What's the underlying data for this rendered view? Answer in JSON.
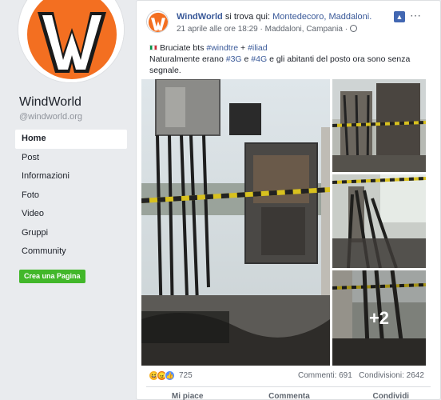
{
  "page": {
    "name": "WindWorld",
    "handle": "@windworld.org",
    "logo_letter": "W"
  },
  "nav": {
    "items": [
      "Home",
      "Post",
      "Informazioni",
      "Foto",
      "Video",
      "Gruppi",
      "Community"
    ],
    "active": "Home",
    "create_button": "Crea una Pagina"
  },
  "post": {
    "author": "WindWorld",
    "checkin_text": "si trova qui:",
    "place": "Montedecoro, Maddaloni.",
    "timestamp": "21 aprile alle ore 18:29",
    "location": "Maddaloni, Campania",
    "line1_prefix": "Bruciate bts",
    "tag_windtre": "#windtre",
    "plus": "+",
    "tag_iliad": "#iliad",
    "line2_a": "Naturalmente erano",
    "tag_3g": "#3G",
    "and": "e",
    "tag_4g": "#4G",
    "line2_b": "e gli abitanti del posto ora sono senza segnale.",
    "more_photos": "+2",
    "reaction_count": "725",
    "comments": "Commenti: 691",
    "shares": "Condivisioni: 2642",
    "actions": [
      "Mi piace",
      "Commenta",
      "Condividi"
    ],
    "colors": {
      "link": "#385898",
      "logo_orange": "#f36f21",
      "create_green": "#42b72a"
    }
  }
}
